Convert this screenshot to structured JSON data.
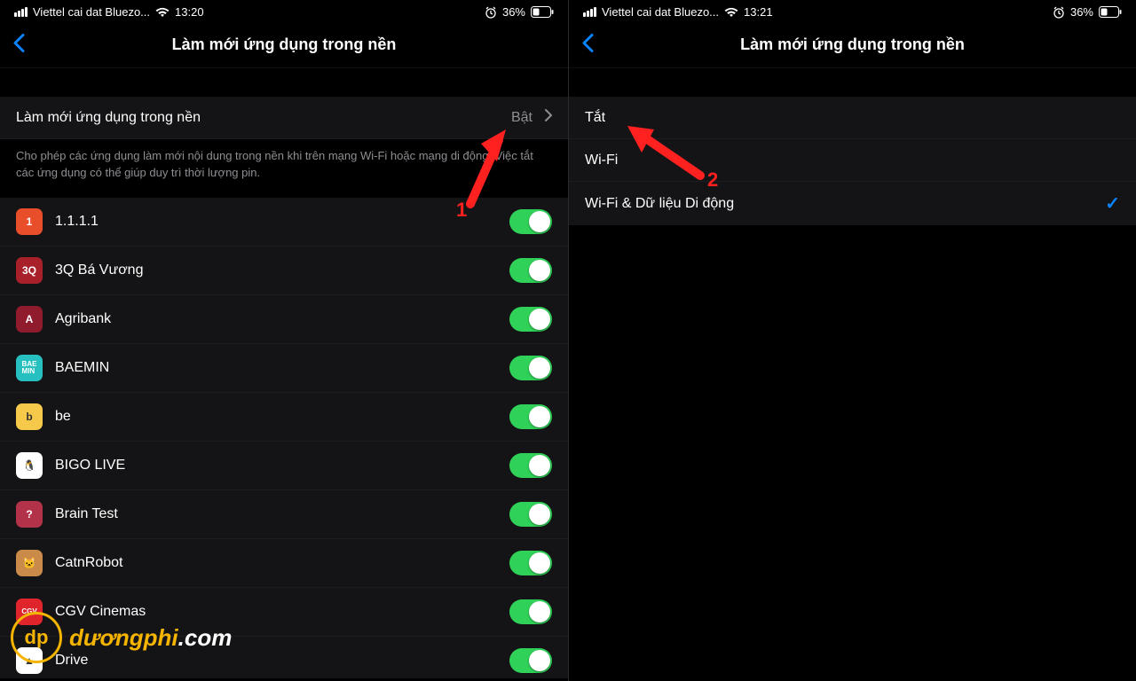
{
  "left": {
    "status": {
      "carrier": "Viettel cai dat Bluezo...",
      "time": "13:20",
      "battery_pct": "36%"
    },
    "nav_title": "Làm mới ứng dụng trong nền",
    "master_row": {
      "label": "Làm mới ứng dụng trong nền",
      "value": "Bật"
    },
    "description": "Cho phép các ứng dụng làm mới nội dung trong nền khi trên mạng Wi-Fi hoặc mạng di động. Việc tắt các ứng dụng có thể giúp duy trì thời lượng pin.",
    "apps": [
      {
        "name": "1.1.1.1",
        "icon_bg": "#e94e2a",
        "icon_txt": "1"
      },
      {
        "name": "3Q Bá Vương",
        "icon_bg": "#a8202a",
        "icon_txt": "3Q"
      },
      {
        "name": "Agribank",
        "icon_bg": "#8f1b2c",
        "icon_txt": "A"
      },
      {
        "name": "BAEMIN",
        "icon_bg": "#27c0c0",
        "icon_txt": "BAE\nMIN"
      },
      {
        "name": "be",
        "icon_bg": "#f7c94b",
        "icon_txt": "b"
      },
      {
        "name": "BIGO LIVE",
        "icon_bg": "#ffffff",
        "icon_txt": "🐧"
      },
      {
        "name": "Brain Test",
        "icon_bg": "#b2324a",
        "icon_txt": "?"
      },
      {
        "name": "CatnRobot",
        "icon_bg": "#c98a4a",
        "icon_txt": "🐱"
      },
      {
        "name": "CGV Cinemas",
        "icon_bg": "#e0242b",
        "icon_txt": "CGV"
      },
      {
        "name": "Drive",
        "icon_bg": "#ffffff",
        "icon_txt": "▲"
      }
    ],
    "arrow_label": "1"
  },
  "right": {
    "status": {
      "carrier": "Viettel cai dat Bluezo...",
      "time": "13:21",
      "battery_pct": "36%"
    },
    "nav_title": "Làm mới ứng dụng trong nền",
    "options": [
      {
        "label": "Tắt",
        "checked": false
      },
      {
        "label": "Wi-Fi",
        "checked": false
      },
      {
        "label": "Wi-Fi & Dữ liệu Di động",
        "checked": true
      }
    ],
    "arrow_label": "2"
  },
  "watermark": {
    "logo_text": "dp",
    "brand": "dươngphi",
    "suffix": ".com"
  }
}
